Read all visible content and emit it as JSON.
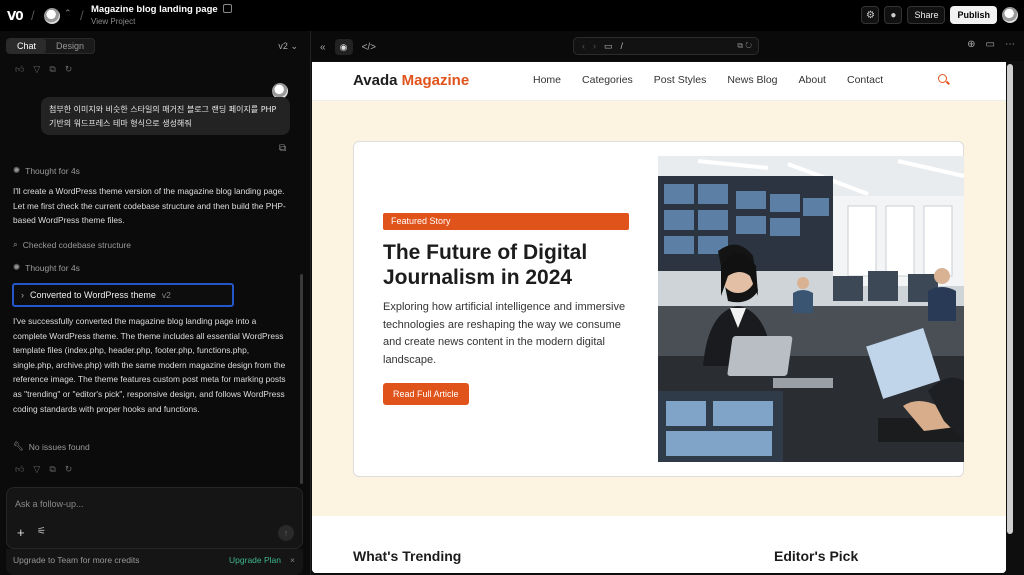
{
  "topbar": {
    "logo": "V0",
    "project_title": "Magazine blog landing page",
    "project_sub": "View Project",
    "share": "Share",
    "publish": "Publish"
  },
  "left": {
    "tabs": [
      "Chat",
      "Design"
    ],
    "version": "v2",
    "user_msg": "첨부한 이미지와 비슷한 스타일의 매거진 블로그 랜딩 페이지를 PHP 기반의 워드프레스 테마 형식으로 생성해줘",
    "thought1": "Thought for 4s",
    "para1": "I'll create a WordPress theme version of the magazine blog landing page. Let me first check the current codebase structure and then build the PHP-based WordPress theme files.",
    "checked": "Checked codebase structure",
    "thought2": "Thought for 4s",
    "converted": "Converted to WordPress theme",
    "converted_ver": "v2",
    "para2": "I've successfully converted the magazine blog landing page into a complete WordPress theme. The theme includes all essential WordPress template files (index.php, header.php, footer.php, functions.php, single.php, archive.php) with the same modern magazine design from the reference image. The theme features custom post meta for marking posts as \"trending\" or \"editor's pick\", responsive design, and follows WordPress coding standards with proper hooks and functions.",
    "no_issues": "No issues found",
    "input_placeholder": "Ask a follow-up...",
    "upgrade_text": "Upgrade to Team for more credits",
    "upgrade_link": "Upgrade Plan"
  },
  "preview": {
    "url": "/",
    "site": {
      "brand_a": "Avada ",
      "brand_b": "Magazine",
      "menu": [
        "Home",
        "Categories",
        "Post Styles",
        "News Blog",
        "About",
        "Contact"
      ],
      "badge": "Featured Story",
      "title": "The Future of Digital Journalism in 2024",
      "desc": "Exploring how artificial intelligence and immersive technologies are reshaping the way we consume and create news content in the modern digital landscape.",
      "cta": "Read Full Article",
      "section_left": "What's Trending",
      "section_right": "Editor's Pick"
    }
  },
  "colors": {
    "accent": "#e0531b",
    "panel": "#0b0b0b",
    "site_bg": "#fdf3e1",
    "focus": "#2356c8"
  }
}
